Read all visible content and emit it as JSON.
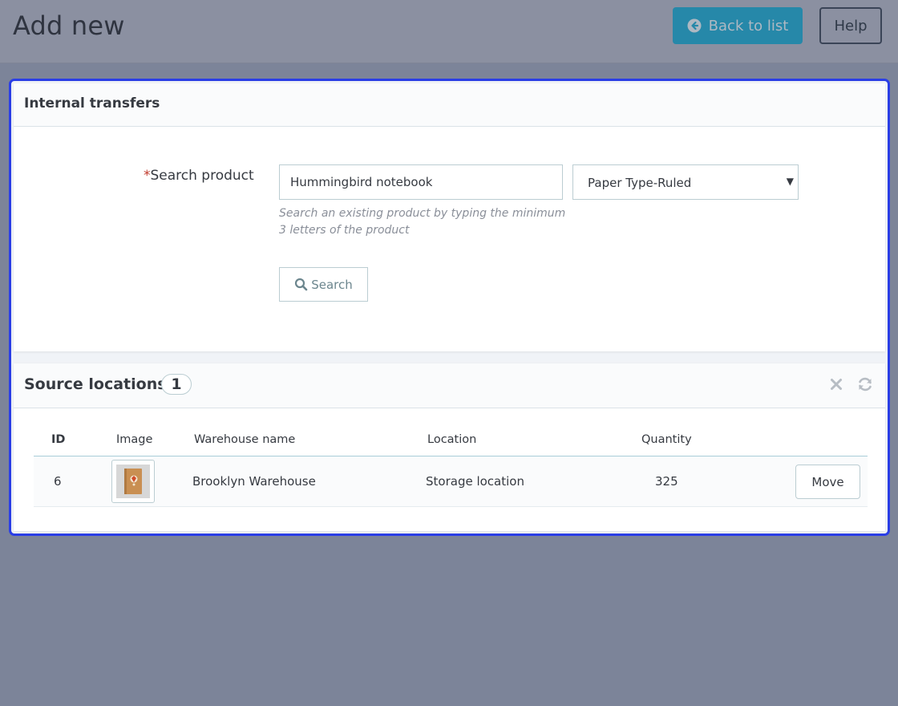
{
  "header": {
    "title": "Add new",
    "back_button": "Back to list",
    "help_button": "Help"
  },
  "internal_transfers": {
    "title": "Internal transfers",
    "search_label_required": "*",
    "search_label": "Search product",
    "search_value": "Hummingbird notebook",
    "variant_select": "Paper Type-Ruled",
    "help_text": "Search an existing product by typing the minimum 3 letters of the product",
    "search_button": "Search"
  },
  "source_locations": {
    "title": "Source locations",
    "count": "1",
    "columns": [
      "ID",
      "Image",
      "Warehouse name",
      "Location",
      "Quantity"
    ],
    "rows": [
      {
        "id": "6",
        "warehouse": "Brooklyn Warehouse",
        "location": "Storage location",
        "quantity": "325",
        "action": "Move"
      }
    ]
  },
  "colors": {
    "accent": "#2688a9",
    "highlight": "#2a3ee6",
    "required": "#c0392b"
  },
  "icons": [
    "arrow-circle-left-icon",
    "search-icon",
    "close-icon",
    "refresh-icon",
    "notebook-thumbnail-icon"
  ]
}
